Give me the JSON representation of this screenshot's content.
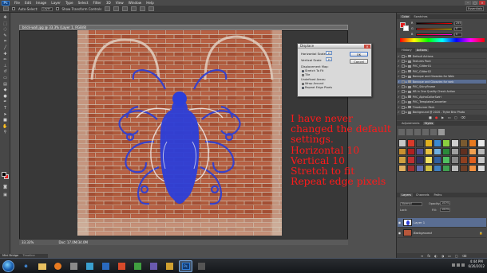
{
  "menubar": {
    "logo": "Ps",
    "items": [
      "File",
      "Edit",
      "Image",
      "Layer",
      "Type",
      "Select",
      "Filter",
      "3D",
      "View",
      "Window",
      "Help"
    ]
  },
  "options": {
    "auto_select_label": "Auto-Select:",
    "auto_select_value": "Layer",
    "transform_label": "Show Transform Controls",
    "workspace": "Essentials"
  },
  "document": {
    "tab_title": "brick-wall.jpg @ 33.3% (Layer 1, RGB/8)",
    "zoom": "33.33%",
    "doc_size": "Doc: 17.0M/34.0M"
  },
  "displace_dialog": {
    "title": "Displace",
    "horizontal_label": "Horizontal Scale",
    "horizontal_value": "10",
    "vertical_label": "Vertical Scale",
    "vertical_value": "10",
    "ok_label": "OK",
    "cancel_label": "Cancel",
    "map_group": "Displacement Map:",
    "map_options": [
      "Stretch To Fit",
      "Tile"
    ],
    "undefined_group": "Undefined Areas:",
    "undefined_options": [
      "Wrap Around",
      "Repeat Edge Pixels"
    ]
  },
  "annotation_lines": [
    "I have never",
    "changed the default",
    "settings.",
    "Horizontal 10",
    "Vertical 10",
    "Stretch to fit",
    "Repeat edge pixels"
  ],
  "color_panel": {
    "tabs": [
      "Color",
      "Swatches"
    ],
    "rows": [
      {
        "label": "R",
        "value": "255"
      },
      {
        "label": "G",
        "value": "0"
      },
      {
        "label": "B",
        "value": "0"
      }
    ]
  },
  "actions_panel": {
    "tabs": [
      "History",
      "Actions"
    ],
    "rows": [
      {
        "label": "Default Actions",
        "selected": false
      },
      {
        "label": "Textures Pack",
        "selected": false
      },
      {
        "label": "PVC_Glitter01",
        "selected": false
      },
      {
        "label": "PVC_Glitter02",
        "selected": false
      },
      {
        "label": "Baroque and Glowzies for Web",
        "selected": false
      },
      {
        "label": "Baroque and Glowzies for web",
        "selected": true
      },
      {
        "label": "PVC_ShinyFrame",
        "selected": false
      },
      {
        "label": "HB in One Quality Check Action",
        "selected": false
      },
      {
        "label": "PVC_AlphaCollarSwirl",
        "selected": false
      },
      {
        "label": "PVC_TemplatesConverter",
        "selected": false
      },
      {
        "label": "Timeturner Pack",
        "selected": false
      },
      {
        "label": "Background @ 2020 - Trybe Brio Photo",
        "selected": false
      }
    ]
  },
  "styles_panel": {
    "tabs": [
      "Adjustments",
      "Styles"
    ]
  },
  "layers_panel": {
    "tabs": [
      "Layers",
      "Channels",
      "Paths"
    ],
    "blend_mode": "Normal",
    "opacity_label": "Opacity:",
    "opacity_value": "100%",
    "fill_label": "Fill:",
    "fill_value": "100%",
    "lock_label": "Lock:",
    "layers": [
      {
        "name": "Layer 1",
        "selected": true
      },
      {
        "name": "Background",
        "selected": false
      }
    ]
  },
  "minibridge": {
    "tabs": [
      "Mini Bridge",
      "Timeline"
    ]
  },
  "taskbar": {
    "time": "4:44 PM",
    "date": "6/26/2012"
  }
}
